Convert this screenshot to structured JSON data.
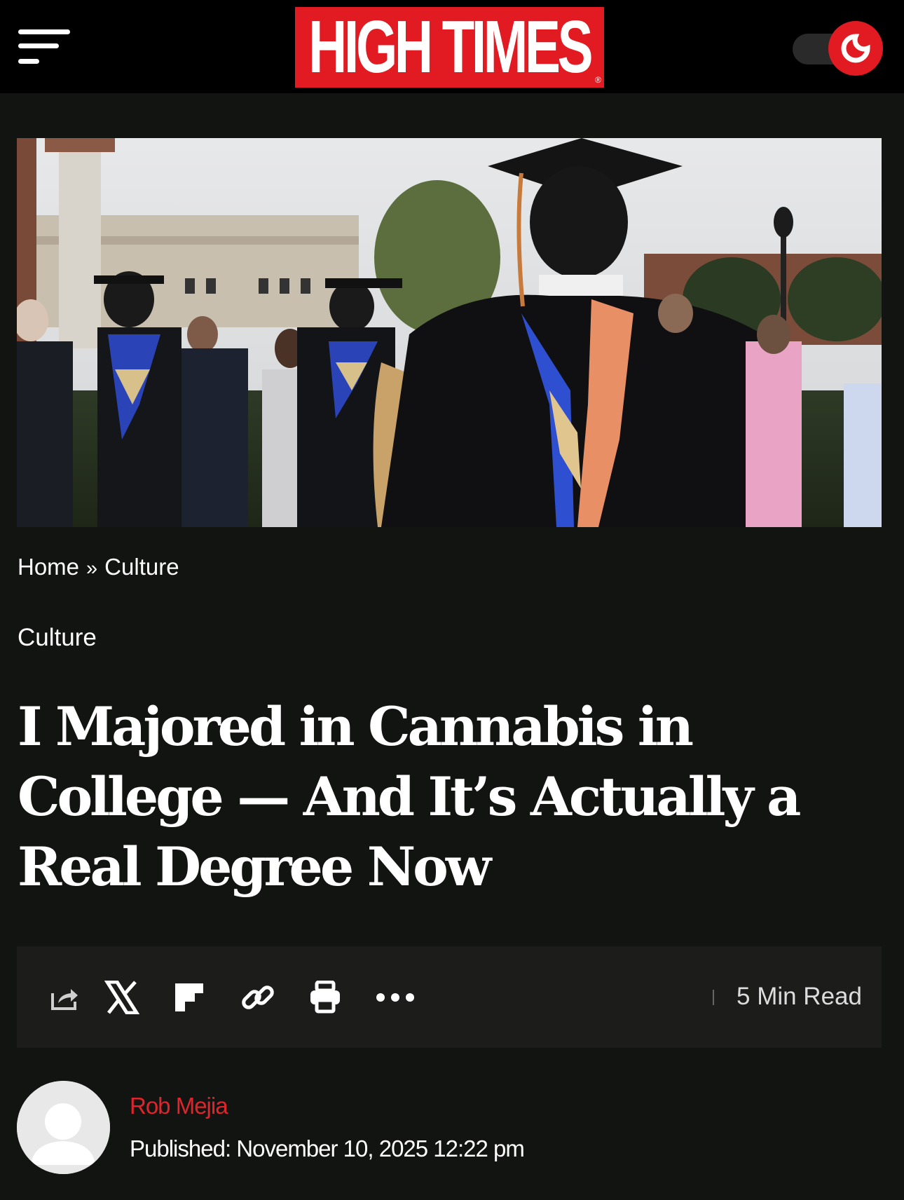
{
  "header": {
    "logo_text": "HIGH TIMES",
    "logo_mark": "®",
    "menu_icon": "hamburger-menu-icon",
    "theme_icon": "moon-icon",
    "brand_color": "#e21b22"
  },
  "breadcrumb": {
    "home": "Home",
    "separator": "»",
    "current": "Culture"
  },
  "article": {
    "category": "Culture",
    "title": "I Majored in Cannabis in College — And It’s Actually a Real Degree Now",
    "read_time": "5 Min Read",
    "share_icons": [
      "share-icon",
      "x-icon",
      "flipboard-icon",
      "link-icon",
      "print-icon",
      "more-icon"
    ]
  },
  "author": {
    "name": "Rob Mejia",
    "published": "Published: November 10, 2025 12:22 pm",
    "name_color": "#e0242b"
  }
}
